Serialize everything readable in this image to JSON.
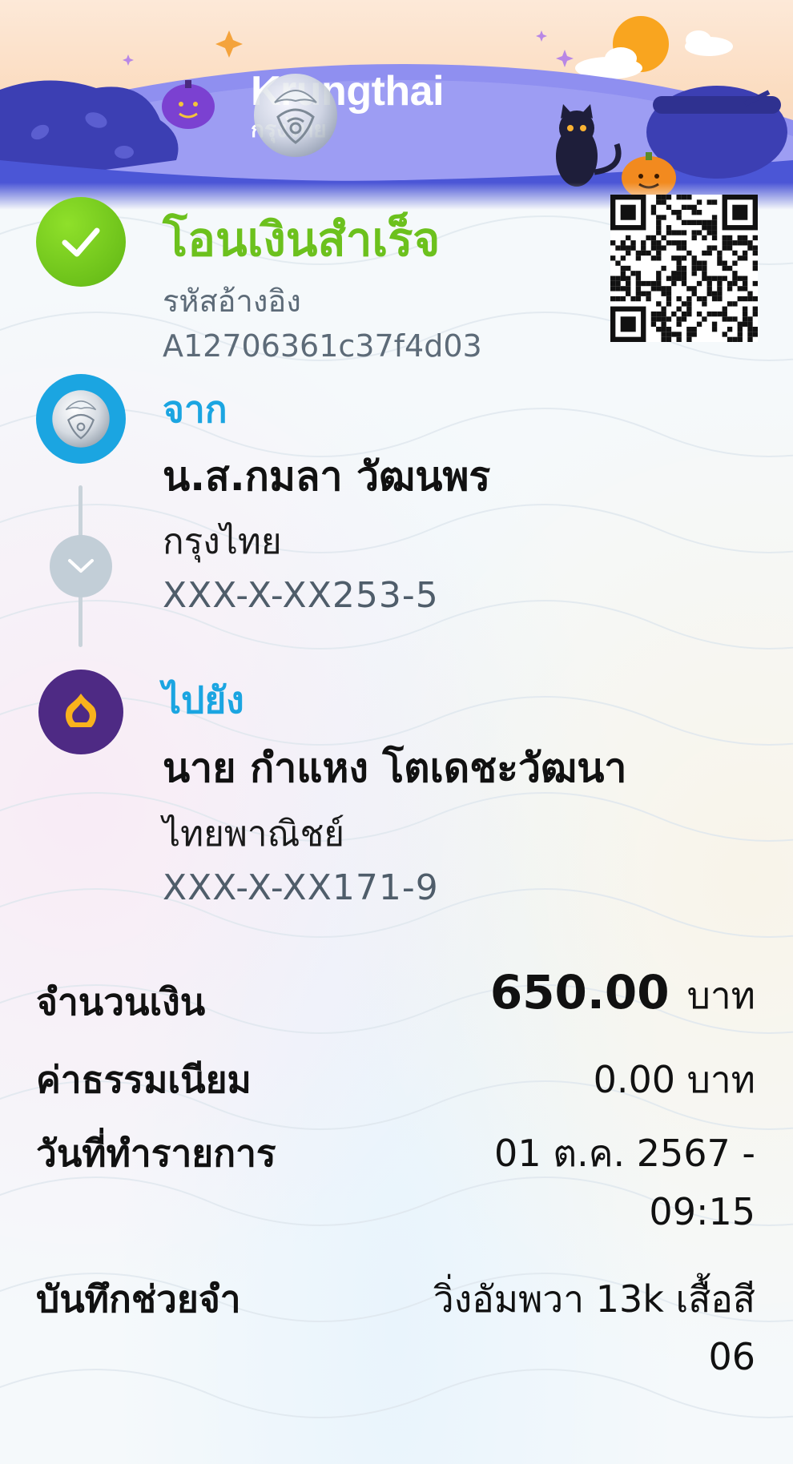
{
  "brand": {
    "name_en": "Krungthai",
    "name_th": "กรุงไทย"
  },
  "status": {
    "title": "โอนเงินสำเร็จ",
    "ref_label": "รหัสอ้างอิง",
    "ref_value": "A12706361c37f4d03"
  },
  "from": {
    "label": "จาก",
    "name": "น.ส.กมลา วัฒนพร",
    "bank": "กรุงไทย",
    "account": "XXX-X-XX253-5"
  },
  "to": {
    "label": "ไปยัง",
    "name": "นาย กำแหง โตเดชะวัฒนา",
    "bank": "ไทยพาณิชย์",
    "account": "XXX-X-XX171-9"
  },
  "details": {
    "amount_label": "จำนวนเงิน",
    "amount_value": "650.00",
    "amount_unit": "บาท",
    "fee_label": "ค่าธรรมเนียม",
    "fee_value": "0.00 บาท",
    "date_label": "วันที่ทำรายการ",
    "date_line1": "01 ต.ค. 2567 -",
    "date_line2": "09:15",
    "memo_label": "บันทึกช่วยจำ",
    "memo_line1": "วิ่งอัมพวา 13k เสื้อสี",
    "memo_line2": "06"
  },
  "colors": {
    "success_green": "#6cc11d",
    "krungthai_blue": "#1ba5e1",
    "scb_purple": "#4e2a84",
    "banner_blue": "#4b56d6"
  },
  "icons": {
    "status": "check-icon",
    "from_bank": "krungthai-logo-icon",
    "to_bank": "scb-logo-icon",
    "divider": "chevron-down-icon"
  }
}
